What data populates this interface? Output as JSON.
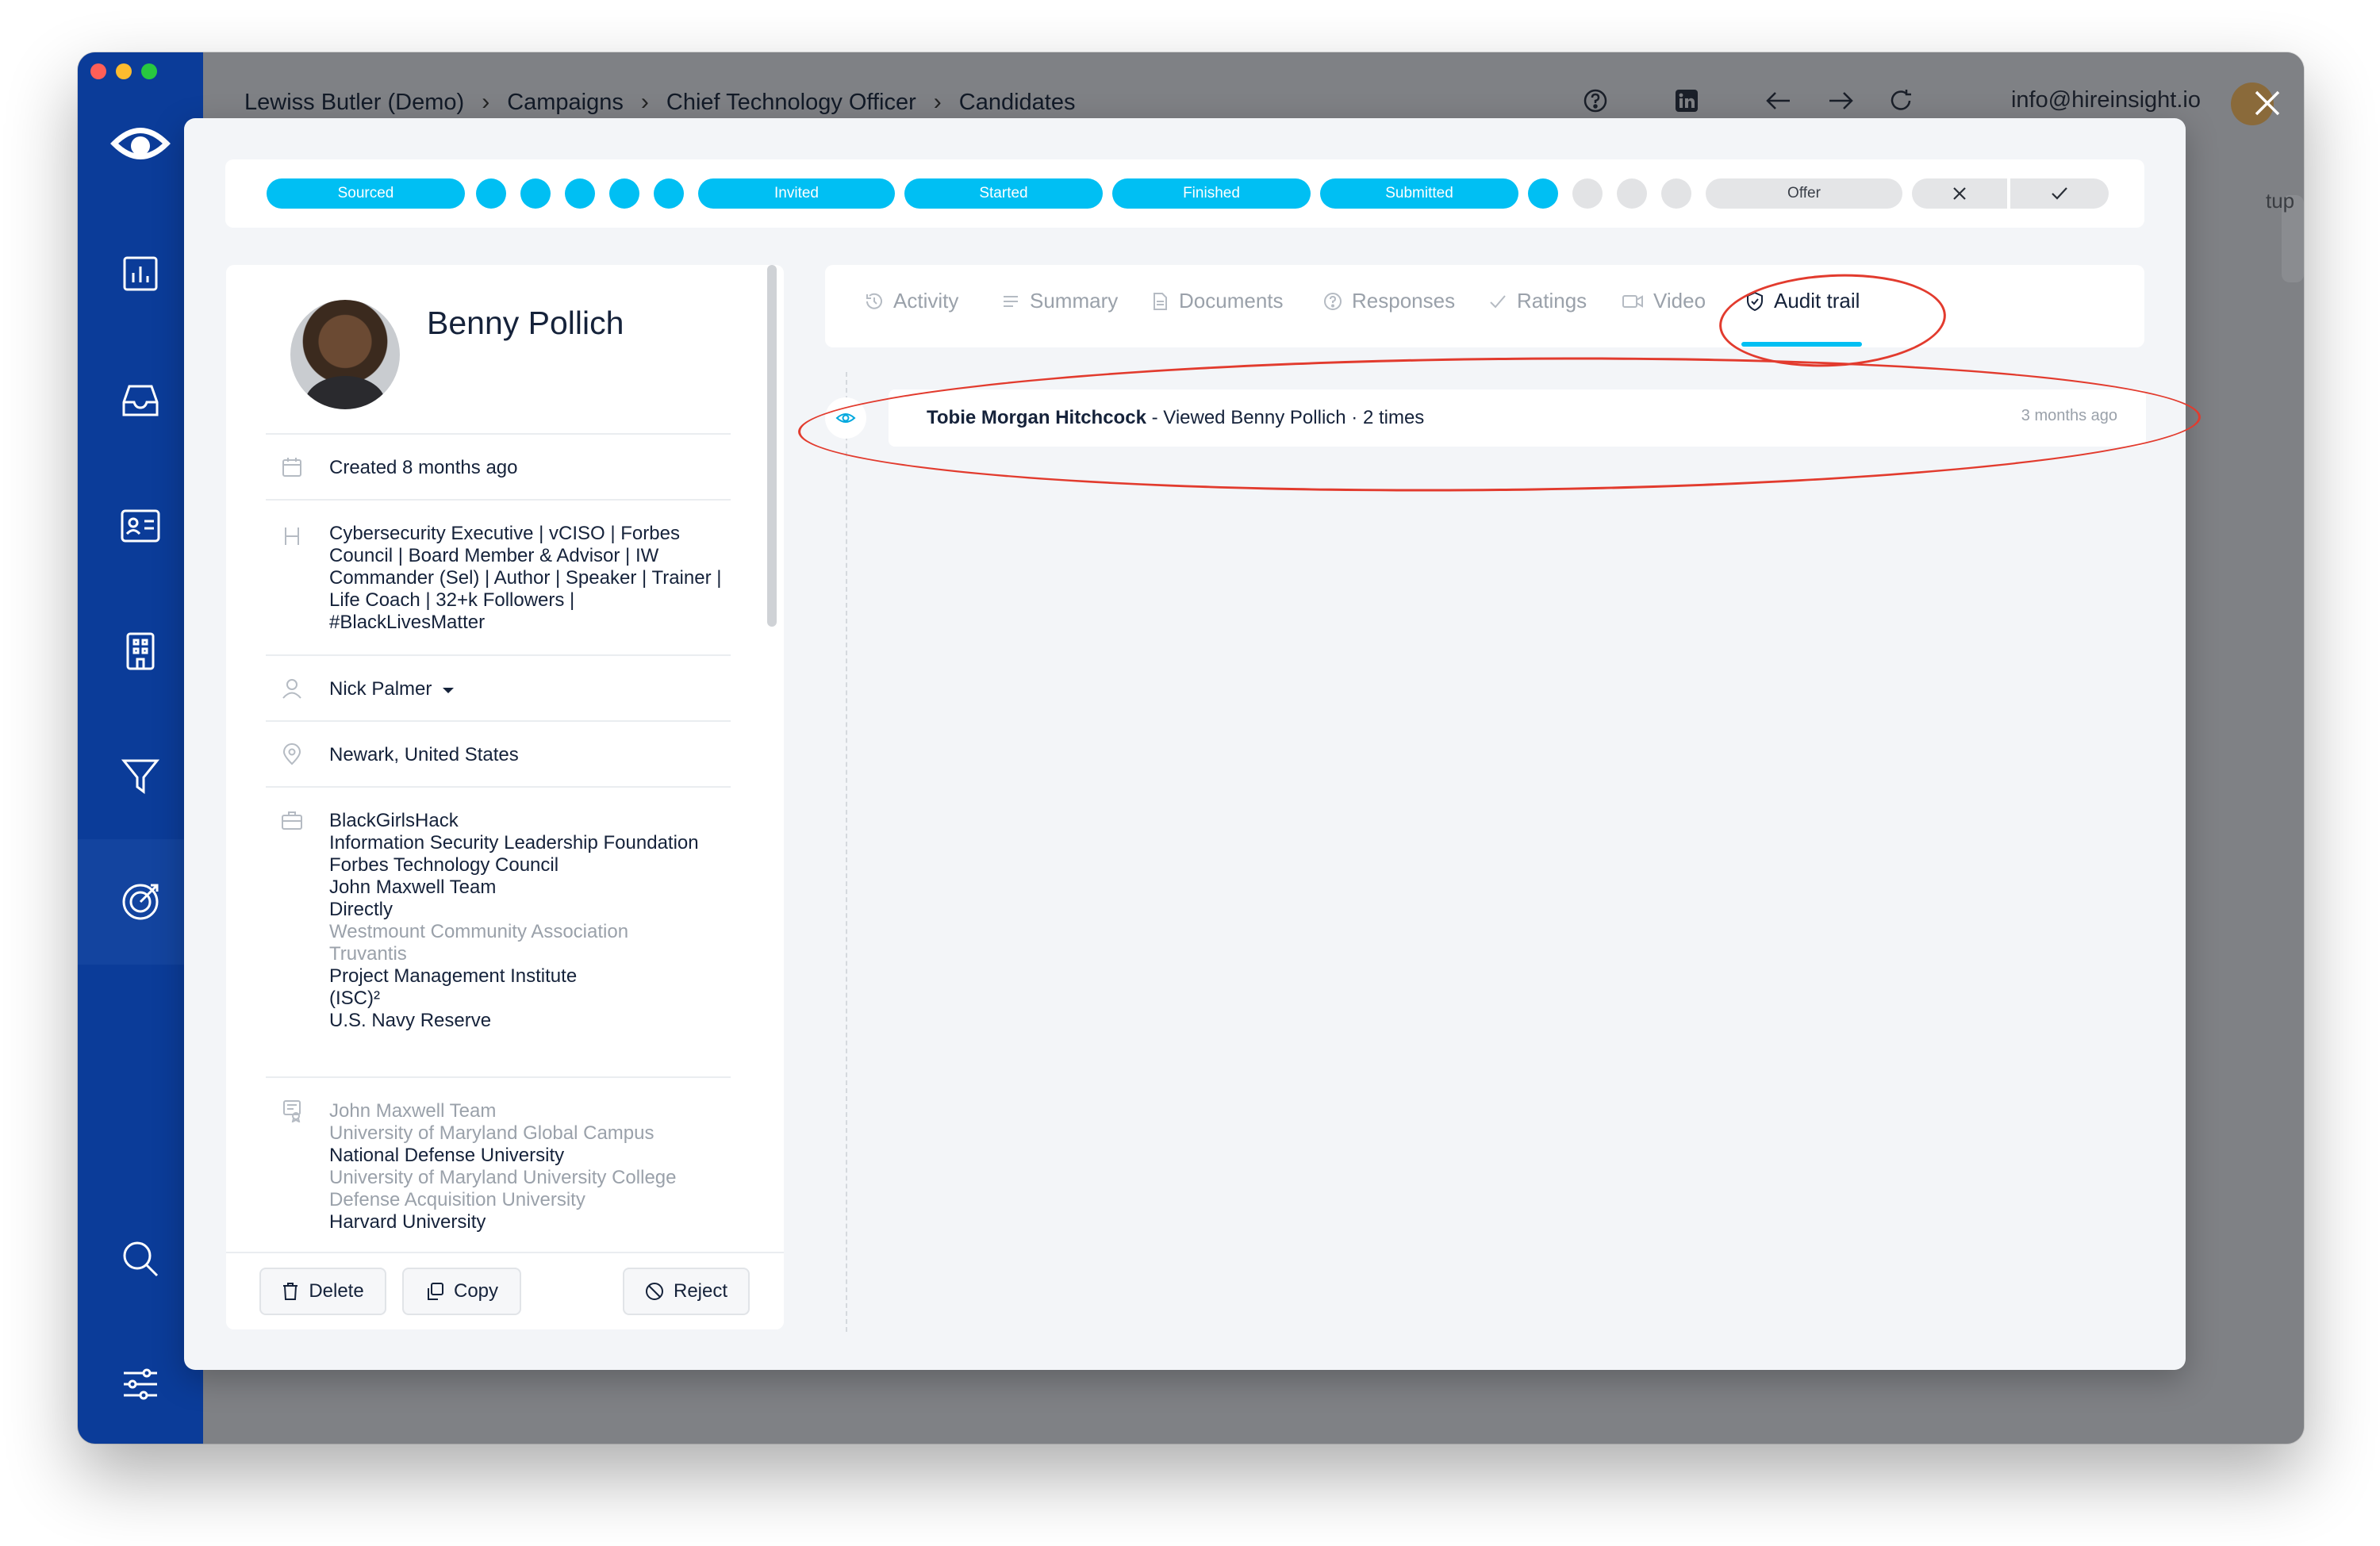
{
  "breadcrumbs": [
    "Lewiss Butler (Demo)",
    "Campaigns",
    "Chief Technology Officer",
    "Candidates"
  ],
  "account_email": "info@hireinsight.io",
  "bg_hint": "tup",
  "stages": {
    "sourced": "Sourced",
    "invited": "Invited",
    "started": "Started",
    "finished": "Finished",
    "submitted": "Submitted",
    "offer": "Offer"
  },
  "profile": {
    "name": "Benny Pollich",
    "created": "Created 8 months ago",
    "headline": "Cybersecurity Executive | vCISO | Forbes Council | Board Member & Advisor | IW Commander (Sel) | Author | Speaker | Trainer | Life Coach | 32+k Followers | #BlackLivesMatter",
    "owner": "Nick Palmer",
    "location": "Newark, United States",
    "experience": [
      {
        "text": "BlackGirlsHack",
        "muted": false
      },
      {
        "text": "Information Security Leadership Foundation",
        "muted": false
      },
      {
        "text": "Forbes Technology Council",
        "muted": false
      },
      {
        "text": "John Maxwell Team",
        "muted": false
      },
      {
        "text": "Directly",
        "muted": false
      },
      {
        "text": "Westmount Community Association",
        "muted": true
      },
      {
        "text": "Truvantis",
        "muted": true
      },
      {
        "text": "Project Management Institute",
        "muted": false
      },
      {
        "text": "(ISC)²",
        "muted": false
      },
      {
        "text": "U.S. Navy Reserve",
        "muted": false
      }
    ],
    "education": [
      {
        "text": "John Maxwell Team",
        "muted": true
      },
      {
        "text": "University of Maryland Global Campus",
        "muted": true
      },
      {
        "text": "National Defense University",
        "muted": false
      },
      {
        "text": "University of Maryland University College",
        "muted": true
      },
      {
        "text": "Defense Acquisition University",
        "muted": true
      },
      {
        "text": "Harvard University",
        "muted": false
      }
    ]
  },
  "actions": {
    "delete": "Delete",
    "copy": "Copy",
    "reject": "Reject"
  },
  "tabs": {
    "activity": "Activity",
    "summary": "Summary",
    "documents": "Documents",
    "responses": "Responses",
    "ratings": "Ratings",
    "video": "Video",
    "audit": "Audit trail"
  },
  "audit_entry": {
    "actor": "Tobie Morgan Hitchcock",
    "action": " - Viewed Benny Pollich · 2 times",
    "time": "3 months ago"
  },
  "colors": {
    "sidebar": "#0b3c99",
    "accent": "#00bff3",
    "annotation": "#e23b2e"
  }
}
